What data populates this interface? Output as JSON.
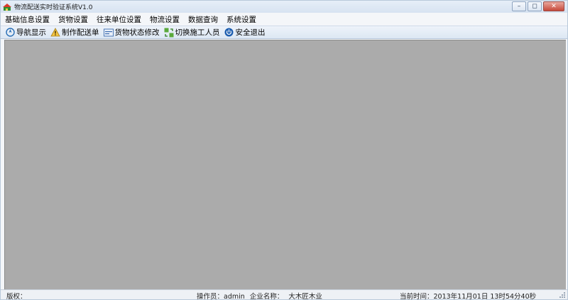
{
  "window": {
    "title": "物流配送实时验证系统V1.0",
    "minimize_glyph": "–",
    "maximize_glyph": "◻",
    "close_glyph": "✕"
  },
  "menu": [
    {
      "label": "基础信息设置"
    },
    {
      "label": "货物设置"
    },
    {
      "label": "往来单位设置"
    },
    {
      "label": "物流设置"
    },
    {
      "label": "数据查询"
    },
    {
      "label": "系统设置"
    }
  ],
  "toolbar": [
    {
      "label": "导航显示",
      "icon": "navigation-icon"
    },
    {
      "label": "制作配送单",
      "icon": "warning-triangle-icon"
    },
    {
      "label": "货物状态修改",
      "icon": "status-edit-icon"
    },
    {
      "label": "切换施工人员",
      "icon": "switch-user-icon"
    },
    {
      "label": "安全退出",
      "icon": "power-exit-icon"
    }
  ],
  "status": {
    "copyright_label": "版权：",
    "operator_label": "操作员：admin",
    "company_label": "企业名称：",
    "company_value": "大木匠木业",
    "time_label": "当前时间：2013年11月01日 13时54分40秒"
  },
  "colors": {
    "workspace": "#ababab",
    "titlebar": "#dbe6f3",
    "close_button": "#c5483a"
  }
}
